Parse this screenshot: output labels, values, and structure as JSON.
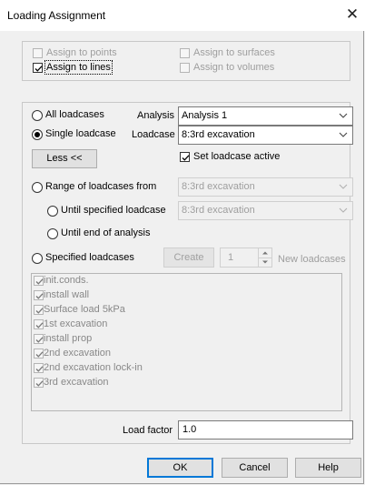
{
  "window": {
    "title": "Loading Assignment",
    "close_glyph": "✕"
  },
  "assign": {
    "points": {
      "label": "Assign to points",
      "checked": false,
      "enabled": false
    },
    "surfaces": {
      "label": "Assign to surfaces",
      "checked": false,
      "enabled": false
    },
    "lines": {
      "label": "Assign to lines",
      "checked": true,
      "enabled": true
    },
    "volumes": {
      "label": "Assign to volumes",
      "checked": false,
      "enabled": false
    }
  },
  "loadcases": {
    "all_label": "All loadcases",
    "analysis_label": "Analysis",
    "analysis_value": "Analysis 1",
    "single_label": "Single loadcase",
    "loadcase_label": "Loadcase",
    "loadcase_value": "8:3rd excavation",
    "less_button": "Less <<",
    "set_active_label": "Set loadcase active",
    "set_active_checked": true,
    "range_label": "Range of loadcases from",
    "range_from_value": "8:3rd excavation",
    "until_specified_label": "Until specified loadcase",
    "until_specified_value": "8:3rd excavation",
    "until_end_label": "Until end of analysis",
    "specified_label": "Specified loadcases",
    "create_button": "Create",
    "spinner_value": "1",
    "new_loadcases_label": "New loadcases",
    "selected_mode": "single"
  },
  "loadcase_list": [
    {
      "label": "init.conds.",
      "checked": true
    },
    {
      "label": "install wall",
      "checked": true
    },
    {
      "label": "Surface load 5kPa",
      "checked": true
    },
    {
      "label": "1st excavation",
      "checked": true
    },
    {
      "label": "install prop",
      "checked": true
    },
    {
      "label": "2nd excavation",
      "checked": true
    },
    {
      "label": "2nd excavation lock-in",
      "checked": true
    },
    {
      "label": "3rd excavation",
      "checked": true
    }
  ],
  "load_factor": {
    "label": "Load factor",
    "value": "1.0"
  },
  "buttons": {
    "ok": "OK",
    "cancel": "Cancel",
    "help": "Help"
  },
  "icons": {
    "close": "close-icon",
    "dropdown": "chevron-down-icon",
    "spinner_up": "spinner-up-icon",
    "spinner_down": "spinner-down-icon",
    "check": "check-icon"
  },
  "colors": {
    "default_button_border": "#0078d7",
    "disabled_text": "#9e9e9e"
  }
}
